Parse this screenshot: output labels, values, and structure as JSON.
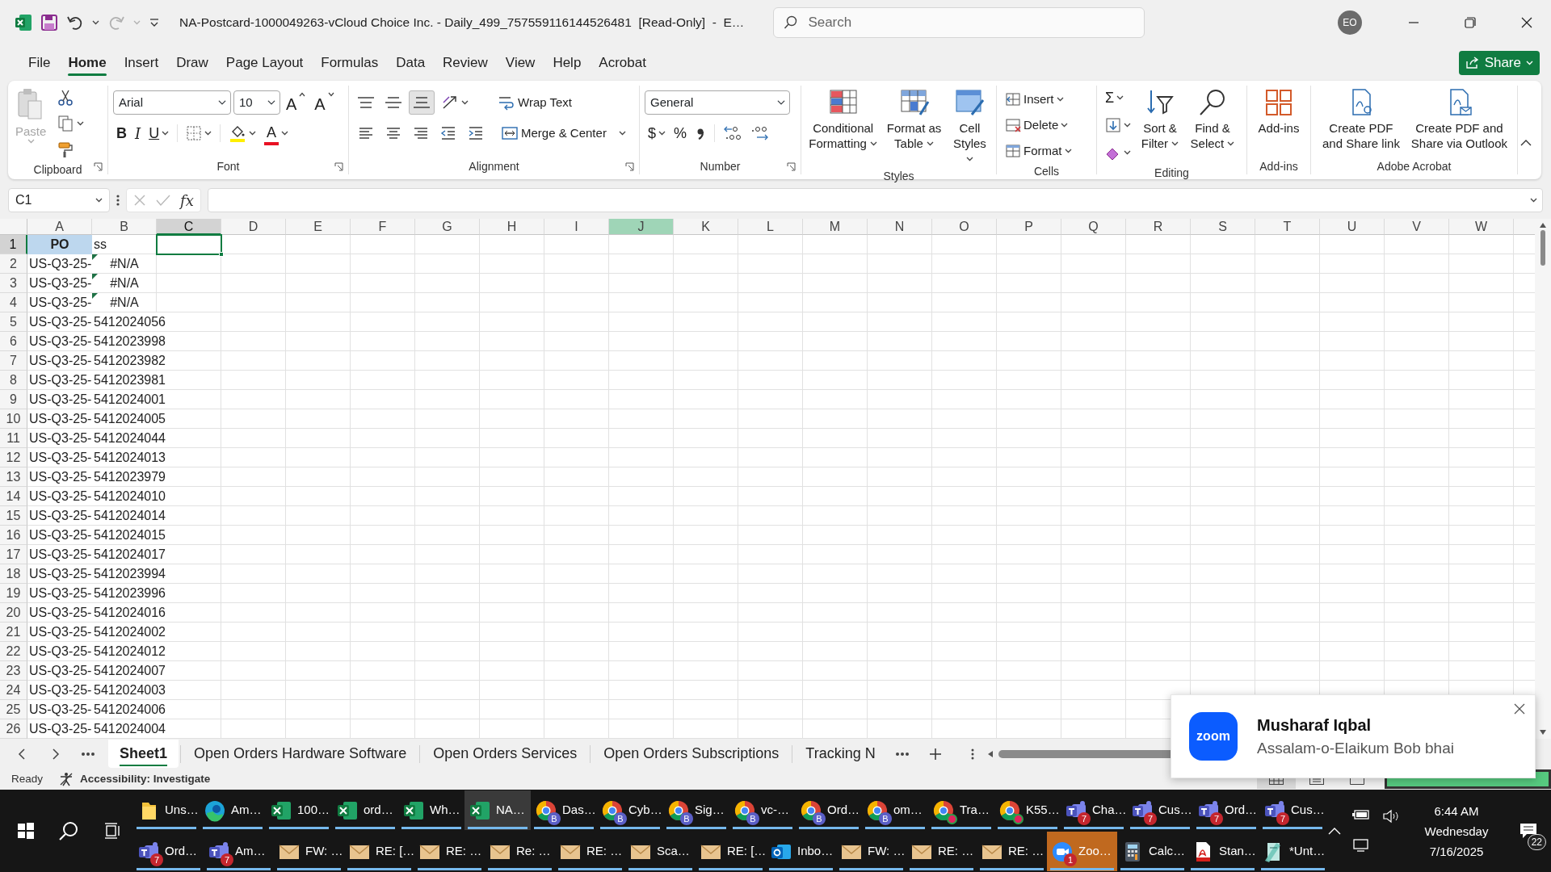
{
  "window": {
    "title": "NA-Postcard-1000049263-vCloud Choice Inc. - Daily_499_757559116144526481  [Read-Only]  -  E…",
    "search_placeholder": "Search",
    "avatar": "EO",
    "redo": {
      "disabled": true
    }
  },
  "tabs": [
    {
      "label": "File",
      "selected": false
    },
    {
      "label": "Home",
      "selected": true
    },
    {
      "label": "Insert",
      "selected": false
    },
    {
      "label": "Draw",
      "selected": false
    },
    {
      "label": "Page Layout",
      "selected": false
    },
    {
      "label": "Formulas",
      "selected": false
    },
    {
      "label": "Data",
      "selected": false
    },
    {
      "label": "Review",
      "selected": false
    },
    {
      "label": "View",
      "selected": false
    },
    {
      "label": "Help",
      "selected": false
    },
    {
      "label": "Acrobat",
      "selected": false
    }
  ],
  "share": "Share",
  "ribbon": {
    "clipboard": {
      "label": "Clipboard",
      "paste": {
        "label": "Paste",
        "disabled": true
      }
    },
    "font": {
      "label": "Font",
      "font_name": "Arial",
      "font_size": "10",
      "grow": "A",
      "shrink": "A",
      "bold": "B",
      "italic": "I",
      "underline": "U",
      "font_color": "A"
    },
    "alignment": {
      "label": "Alignment",
      "vertical": [
        {
          "selected": false
        },
        {
          "selected": false
        },
        {
          "selected": true
        }
      ],
      "wrap_text": "Wrap Text",
      "merge": "Merge & Center"
    },
    "number": {
      "label": "Number",
      "format": "General",
      "currency": "$",
      "percent": "%"
    },
    "styles": {
      "label": "Styles",
      "buttons": [
        "Conditional Formatting",
        "Format as Table",
        "Cell Styles"
      ]
    },
    "cells": {
      "label": "Cells",
      "buttons": [
        "Insert",
        "Delete",
        "Format"
      ]
    },
    "editing": {
      "label": "Editing",
      "autosum": "Σ",
      "sort": "Sort & Filter",
      "find": "Find & Select"
    },
    "addins": {
      "label": "Add-ins",
      "button": "Add-ins"
    },
    "acrobat": {
      "label": "Adobe Acrobat",
      "buttons": [
        "Create PDF and Share link",
        "Create PDF and Share via Outlook"
      ]
    }
  },
  "formula_bar": {
    "name_box": "C1",
    "fx": "fx",
    "confirm_disabled": true
  },
  "columns": [
    {
      "label": "A",
      "selected": false,
      "hovered": false
    },
    {
      "label": "B",
      "selected": false,
      "hovered": false
    },
    {
      "label": "C",
      "selected": true,
      "hovered": false
    },
    {
      "label": "D",
      "selected": false,
      "hovered": false
    },
    {
      "label": "E",
      "selected": false,
      "hovered": false
    },
    {
      "label": "F",
      "selected": false,
      "hovered": false
    },
    {
      "label": "G",
      "selected": false,
      "hovered": false
    },
    {
      "label": "H",
      "selected": false,
      "hovered": false
    },
    {
      "label": "I",
      "selected": false,
      "hovered": false
    },
    {
      "label": "J",
      "selected": false,
      "hovered": true
    },
    {
      "label": "K",
      "selected": false,
      "hovered": false
    },
    {
      "label": "L",
      "selected": false,
      "hovered": false
    },
    {
      "label": "M",
      "selected": false,
      "hovered": false
    },
    {
      "label": "N",
      "selected": false,
      "hovered": false
    },
    {
      "label": "O",
      "selected": false,
      "hovered": false
    },
    {
      "label": "P",
      "selected": false,
      "hovered": false
    },
    {
      "label": "Q",
      "selected": false,
      "hovered": false
    },
    {
      "label": "R",
      "selected": false,
      "hovered": false
    },
    {
      "label": "S",
      "selected": false,
      "hovered": false
    },
    {
      "label": "T",
      "selected": false,
      "hovered": false
    },
    {
      "label": "U",
      "selected": false,
      "hovered": false
    },
    {
      "label": "V",
      "selected": false,
      "hovered": false
    },
    {
      "label": "W",
      "selected": false,
      "hovered": false
    }
  ],
  "rows": [
    {
      "number": "1",
      "kind": "header",
      "selected": true,
      "a": "PO",
      "b": "ss"
    },
    {
      "number": "2",
      "kind": "error",
      "selected": false,
      "a": "US-Q3-25-",
      "b": "#N/A"
    },
    {
      "number": "3",
      "kind": "error",
      "selected": false,
      "a": "US-Q3-25-",
      "b": "#N/A"
    },
    {
      "number": "4",
      "kind": "error",
      "selected": false,
      "a": "US-Q3-25-",
      "b": "#N/A"
    },
    {
      "number": "5",
      "kind": "value",
      "selected": false,
      "a": "US-Q3-25-",
      "b": "5412024056"
    },
    {
      "number": "6",
      "kind": "value",
      "selected": false,
      "a": "US-Q3-25-",
      "b": "5412023998"
    },
    {
      "number": "7",
      "kind": "value",
      "selected": false,
      "a": "US-Q3-25-",
      "b": "5412023982"
    },
    {
      "number": "8",
      "kind": "value",
      "selected": false,
      "a": "US-Q3-25-",
      "b": "5412023981"
    },
    {
      "number": "9",
      "kind": "value",
      "selected": false,
      "a": "US-Q3-25-",
      "b": "5412024001"
    },
    {
      "number": "10",
      "kind": "value",
      "selected": false,
      "a": "US-Q3-25-",
      "b": "5412024005"
    },
    {
      "number": "11",
      "kind": "value",
      "selected": false,
      "a": "US-Q3-25-",
      "b": "5412024044"
    },
    {
      "number": "12",
      "kind": "value",
      "selected": false,
      "a": "US-Q3-25-",
      "b": "5412024013"
    },
    {
      "number": "13",
      "kind": "value",
      "selected": false,
      "a": "US-Q3-25-",
      "b": "5412023979"
    },
    {
      "number": "14",
      "kind": "value",
      "selected": false,
      "a": "US-Q3-25-",
      "b": "5412024010"
    },
    {
      "number": "15",
      "kind": "value",
      "selected": false,
      "a": "US-Q3-25-",
      "b": "5412024014"
    },
    {
      "number": "16",
      "kind": "value",
      "selected": false,
      "a": "US-Q3-25-",
      "b": "5412024015"
    },
    {
      "number": "17",
      "kind": "value",
      "selected": false,
      "a": "US-Q3-25-",
      "b": "5412024017"
    },
    {
      "number": "18",
      "kind": "value",
      "selected": false,
      "a": "US-Q3-25-",
      "b": "5412023994"
    },
    {
      "number": "19",
      "kind": "value",
      "selected": false,
      "a": "US-Q3-25-",
      "b": "5412023996"
    },
    {
      "number": "20",
      "kind": "value",
      "selected": false,
      "a": "US-Q3-25-",
      "b": "5412024016"
    },
    {
      "number": "21",
      "kind": "value",
      "selected": false,
      "a": "US-Q3-25-",
      "b": "5412024002"
    },
    {
      "number": "22",
      "kind": "value",
      "selected": false,
      "a": "US-Q3-25-",
      "b": "5412024012"
    },
    {
      "number": "23",
      "kind": "value",
      "selected": false,
      "a": "US-Q3-25-",
      "b": "5412024007"
    },
    {
      "number": "24",
      "kind": "value",
      "selected": false,
      "a": "US-Q3-25-",
      "b": "5412024003"
    },
    {
      "number": "25",
      "kind": "value",
      "selected": false,
      "a": "US-Q3-25-",
      "b": "5412024006"
    },
    {
      "number": "26",
      "kind": "value",
      "selected": false,
      "a": "US-Q3-25-",
      "b": "5412024004"
    }
  ],
  "sheet_tabs": [
    {
      "label": "Sheet1",
      "selected": true
    },
    {
      "label": "Open Orders Hardware Software",
      "selected": false
    },
    {
      "label": "Open Orders Services",
      "selected": false
    },
    {
      "label": "Open Orders Subscriptions",
      "selected": false
    },
    {
      "label": "Tracking N",
      "selected": false
    }
  ],
  "status_bar": {
    "ready": "Ready",
    "accessibility": "Accessibility: Investigate",
    "views": [
      {
        "selected": true
      },
      {
        "selected": false
      },
      {
        "selected": false
      }
    ]
  },
  "toast": {
    "logo": "zoom",
    "title": "Musharaf Iqbal",
    "message": "Assalam-o-Elaikum Bob bhai"
  },
  "taskbar": {
    "top_row": [
      {
        "label": "Uns…",
        "kind": "folder",
        "selected": false,
        "attention": false
      },
      {
        "label": "Am…",
        "kind": "edge",
        "selected": false,
        "attention": false
      },
      {
        "label": "100…",
        "kind": "excel",
        "selected": false,
        "attention": false
      },
      {
        "label": "ord…",
        "kind": "excel",
        "selected": false,
        "attention": false
      },
      {
        "label": "Wh…",
        "kind": "excel",
        "selected": false,
        "attention": false
      },
      {
        "label": "NA…",
        "kind": "excel",
        "selected": true,
        "attention": false
      },
      {
        "label": "Das…",
        "kind": "chrome",
        "selected": false,
        "attention": false,
        "badge": "B"
      },
      {
        "label": "Cyb…",
        "kind": "chrome",
        "selected": false,
        "attention": false,
        "badge": "B"
      },
      {
        "label": "Sig…",
        "kind": "chrome",
        "selected": false,
        "attention": false,
        "badge": "B"
      },
      {
        "label": "vc-…",
        "kind": "chrome",
        "selected": false,
        "attention": false,
        "badge": "B"
      },
      {
        "label": "Ord…",
        "kind": "chrome",
        "selected": false,
        "attention": false,
        "badge": "B"
      },
      {
        "label": "om…",
        "kind": "chrome",
        "selected": false,
        "attention": false,
        "badge": "B"
      },
      {
        "label": "Tra…",
        "kind": "chrome",
        "selected": false,
        "attention": false,
        "alert": true
      },
      {
        "label": "K55…",
        "kind": "chrome",
        "selected": false,
        "attention": false,
        "alert": true
      },
      {
        "label": "Cha…",
        "kind": "teams",
        "selected": false,
        "attention": false,
        "badge": "7"
      },
      {
        "label": "Cus…",
        "kind": "teams",
        "selected": false,
        "attention": false,
        "badge": "7"
      },
      {
        "label": "Ord…",
        "kind": "teams",
        "selected": false,
        "attention": false,
        "badge": "7"
      },
      {
        "label": "Cus…",
        "kind": "teams",
        "selected": false,
        "attention": false,
        "badge": "7"
      }
    ],
    "bottom_row": [
      {
        "label": "Ord…",
        "kind": "teams",
        "selected": false,
        "attention": false,
        "badge": "7"
      },
      {
        "label": "Am…",
        "kind": "teams",
        "selected": false,
        "attention": false,
        "badge": "7"
      },
      {
        "label": "FW: …",
        "kind": "mail",
        "selected": false,
        "attention": false
      },
      {
        "label": "RE: […",
        "kind": "mail",
        "selected": false,
        "attention": false
      },
      {
        "label": "RE: …",
        "kind": "mail",
        "selected": false,
        "attention": false
      },
      {
        "label": "Re: …",
        "kind": "mail",
        "selected": false,
        "attention": false
      },
      {
        "label": "RE: …",
        "kind": "mail",
        "selected": false,
        "attention": false
      },
      {
        "label": "Sca…",
        "kind": "mail",
        "selected": false,
        "attention": false
      },
      {
        "label": "RE: […",
        "kind": "mail",
        "selected": false,
        "attention": false
      },
      {
        "label": "Inbo…",
        "kind": "outlook",
        "selected": false,
        "attention": false
      },
      {
        "label": "FW: …",
        "kind": "mail",
        "selected": false,
        "attention": false
      },
      {
        "label": "RE: …",
        "kind": "mail",
        "selected": false,
        "attention": false
      },
      {
        "label": "RE: …",
        "kind": "mail",
        "selected": false,
        "attention": false
      },
      {
        "label": "Zoo…",
        "kind": "zoom",
        "selected": false,
        "attention": true,
        "badge": "1"
      },
      {
        "label": "Calc…",
        "kind": "calc",
        "selected": false,
        "attention": false
      },
      {
        "label": "Stan…",
        "kind": "pdf",
        "selected": false,
        "attention": false
      },
      {
        "label": "*Unt…",
        "kind": "notepad",
        "selected": false,
        "attention": false
      }
    ],
    "tray": {
      "time": "6:44 AM",
      "day": "Wednesday",
      "date": "7/16/2025",
      "notifications": "22"
    }
  }
}
